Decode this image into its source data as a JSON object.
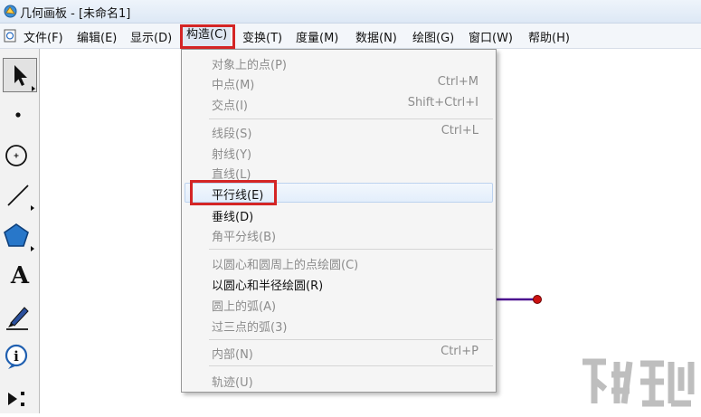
{
  "window": {
    "title": "几何画板 - [未命名1]"
  },
  "menubar": {
    "items": [
      {
        "id": "file",
        "label": "文件(F)"
      },
      {
        "id": "edit",
        "label": "编辑(E)"
      },
      {
        "id": "display",
        "label": "显示(D)"
      },
      {
        "id": "construct",
        "label": "构造(C)",
        "active": true
      },
      {
        "id": "transform",
        "label": "变换(T)"
      },
      {
        "id": "measure",
        "label": "度量(M)"
      },
      {
        "id": "data",
        "label": "数据(N)"
      },
      {
        "id": "graph",
        "label": "绘图(G)"
      },
      {
        "id": "window",
        "label": "窗口(W)"
      },
      {
        "id": "help",
        "label": "帮助(H)"
      }
    ]
  },
  "toolbox": {
    "tools": [
      {
        "name": "selection-arrow-tool",
        "icon": "arrow-icon",
        "selected": true
      },
      {
        "name": "point-tool",
        "icon": "point-icon"
      },
      {
        "name": "compass-tool",
        "icon": "circle-icon"
      },
      {
        "name": "straightedge-tool",
        "icon": "segment-icon"
      },
      {
        "name": "polygon-tool",
        "icon": "pentagon-icon"
      },
      {
        "name": "text-tool",
        "icon": "text-icon",
        "glyph": "A"
      },
      {
        "name": "marker-tool",
        "icon": "pen-icon"
      },
      {
        "name": "information-tool",
        "icon": "info-icon"
      },
      {
        "name": "custom-tool",
        "icon": "custom-tool-icon"
      }
    ]
  },
  "dropdown": {
    "items": [
      {
        "name": "point-on-object",
        "label": "对象上的点(P)",
        "shortcut": "",
        "enabled": false
      },
      {
        "name": "midpoint",
        "label": "中点(M)",
        "shortcut": "Ctrl+M",
        "enabled": false
      },
      {
        "name": "intersection",
        "label": "交点(I)",
        "shortcut": "Shift+Ctrl+I",
        "enabled": false
      },
      {
        "name": "segment",
        "label": "线段(S)",
        "shortcut": "Ctrl+L",
        "enabled": false
      },
      {
        "name": "ray",
        "label": "射线(Y)",
        "shortcut": "",
        "enabled": false
      },
      {
        "name": "line",
        "label": "直线(L)",
        "shortcut": "",
        "enabled": false
      },
      {
        "name": "parallel-line",
        "label": "平行线(E)",
        "shortcut": "",
        "enabled": true,
        "highlighted": true
      },
      {
        "name": "perpendicular-line",
        "label": "垂线(D)",
        "shortcut": "",
        "enabled": true
      },
      {
        "name": "angle-bisector",
        "label": "角平分线(B)",
        "shortcut": "",
        "enabled": false
      },
      {
        "name": "circle-by-center-point",
        "label": "以圆心和圆周上的点绘圆(C)",
        "shortcut": "",
        "enabled": false
      },
      {
        "name": "circle-by-center-radius",
        "label": "以圆心和半径绘圆(R)",
        "shortcut": "",
        "enabled": true
      },
      {
        "name": "arc-on-circle",
        "label": "圆上的弧(A)",
        "shortcut": "",
        "enabled": false
      },
      {
        "name": "arc-through-3-points",
        "label": "过三点的弧(3)",
        "shortcut": "",
        "enabled": false
      },
      {
        "name": "interior",
        "label": "内部(N)",
        "shortcut": "Ctrl+P",
        "enabled": false
      },
      {
        "name": "locus",
        "label": "轨迹(U)",
        "shortcut": "",
        "enabled": false
      }
    ]
  },
  "canvas": {
    "segment_color": "#4a0f8f",
    "point_color": "#cc1111"
  },
  "colors": {
    "annotation_red": "#d42525",
    "menu_highlight_border": "#bcd2ef",
    "disabled_text": "#8c8c8c"
  }
}
